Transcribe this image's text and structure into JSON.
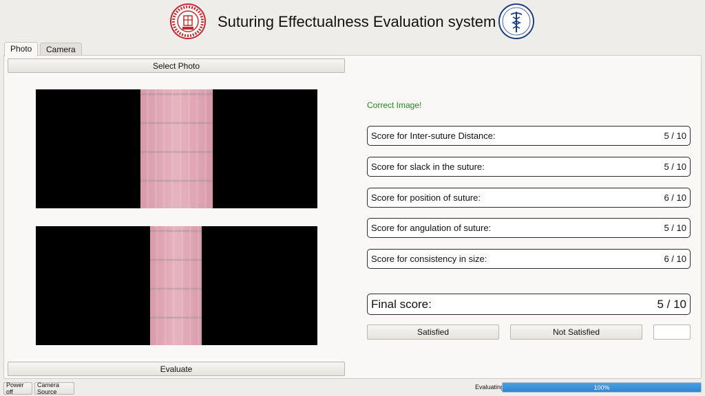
{
  "header": {
    "title": "Suturing Effectualness Evaluation system",
    "left_logo_icon": "institute-emblem-icon",
    "right_logo_icon": "medical-caduceus-icon"
  },
  "tabs": [
    {
      "label": "Photo",
      "active": true
    },
    {
      "label": "Camera",
      "active": false
    }
  ],
  "photo_panel": {
    "select_button": "Select Photo",
    "evaluate_button": "Evaluate"
  },
  "results": {
    "status": "Correct Image!",
    "scores": [
      {
        "label": "Score for Inter-suture Distance:",
        "value": "5 / 10"
      },
      {
        "label": "Score for slack in the suture:",
        "value": "5 / 10"
      },
      {
        "label": "Score for position of suture:",
        "value": "6 / 10"
      },
      {
        "label": "Score for angulation of suture:",
        "value": "5 / 10"
      },
      {
        "label": "Score for consistency in size:",
        "value": "6 / 10"
      }
    ],
    "final": {
      "label": "Final score:",
      "value": "5 / 10"
    },
    "satisfied_button": "Satisfied",
    "not_satisfied_button": "Not Satisfied",
    "feedback_value": ""
  },
  "footer": {
    "power_button": "Power off",
    "camera_source_button": "Camera Source",
    "progress_label": "Evaluating",
    "progress_text": "100%",
    "progress_fraction": 1.0
  },
  "colors": {
    "status_ok": "#1f8a1f",
    "progress": "#3a8fd6",
    "logo_red": "#c8262b",
    "logo_blue": "#1a3a8a"
  }
}
